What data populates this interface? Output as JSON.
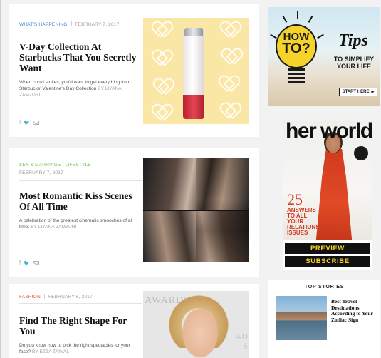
{
  "articles": [
    {
      "category": "WHAT'S HAPPENING",
      "date": "FEBRUARY 7, 2017",
      "title": "V-Day Collection At Starbucks That You Secretly Want",
      "excerpt": "When cupid strikes, you'd want to get everything from Starbucks' Valentine's Day Collection",
      "author": "BY LIYANA ZAMZURI",
      "category_color": "#3c7fd6"
    },
    {
      "category": "SEX & MARRIAGE",
      "category2": "LIFESTYLE",
      "date": "FEBRUARY 7, 2017",
      "title": "Most Romantic Kiss Scenes Of All Time",
      "excerpt": "A celebration of the greatest cinematic smooches of all time.",
      "author": "BY LIYANA ZAMZURI",
      "category_color": "#7cc24a"
    },
    {
      "category": "FASHION",
      "date": "FEBRUARY 6, 2017",
      "title": "Find The Right Shape For You",
      "excerpt": "Do you know how to pick the right spectacles for your face?",
      "author": "BY EZZA ZAINAL",
      "category_color": "#e0553a"
    }
  ],
  "share_icons": [
    "facebook-icon",
    "twitter-icon",
    "email-icon"
  ],
  "share_glyphs": {
    "facebook": "f",
    "twitter": "🐦"
  },
  "images": {
    "card3_backdrop_text": "AWARDS",
    "card3_backdrop_text2": "AD\nS"
  },
  "ad_tips": {
    "how": "HOW",
    "to": "TO?",
    "title": "Tips",
    "subtitle": "TO SIMPLIFY YOUR LIFE",
    "cta": "START HERE",
    "cta_arrow": "▶"
  },
  "ad_magazine": {
    "masthead": "her world",
    "cover_number": "25",
    "cover_headline": "ANSWERS TO ALL YOUR RELATIONSHIP ISSUES",
    "preview_label": "PREVIEW",
    "subscribe_label": "SUBSCRIBE",
    "button_text_color": "#f6d32b"
  },
  "top_stories": {
    "heading": "TOP STORIES",
    "items": [
      {
        "title": "Best Travel Destinations According to Your Zodiac Sign"
      }
    ]
  }
}
